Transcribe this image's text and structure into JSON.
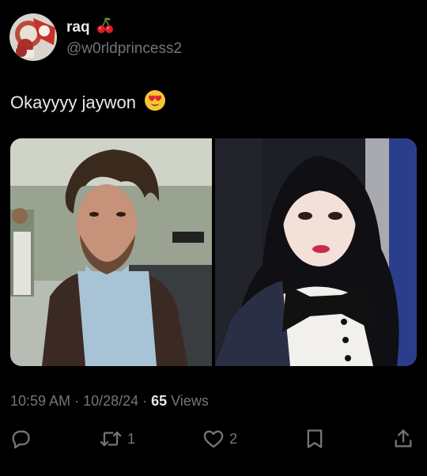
{
  "author": {
    "display_name": "raq",
    "handle": "@w0rldprincess2",
    "name_emoji": "cherries-emoji"
  },
  "tweet": {
    "text": "Okayyyy jaywon",
    "emoji": "heart-eyes-emoji"
  },
  "media": [
    {
      "description": "photo-man-curly-hair"
    },
    {
      "description": "photo-woman-bow-tie"
    }
  ],
  "meta": {
    "time": "10:59 AM",
    "separator": "·",
    "date": "10/28/24",
    "views_count": "65",
    "views_label": "Views"
  },
  "actions": {
    "reply_icon": "reply-icon",
    "retweet_icon": "retweet-icon",
    "retweet_count": "1",
    "like_icon": "heart-icon",
    "like_count": "2",
    "bookmark_icon": "bookmark-icon",
    "share_icon": "share-icon"
  },
  "colors": {
    "background": "#000000",
    "primary_text": "#e7e9ea",
    "secondary_text": "#71767b"
  }
}
